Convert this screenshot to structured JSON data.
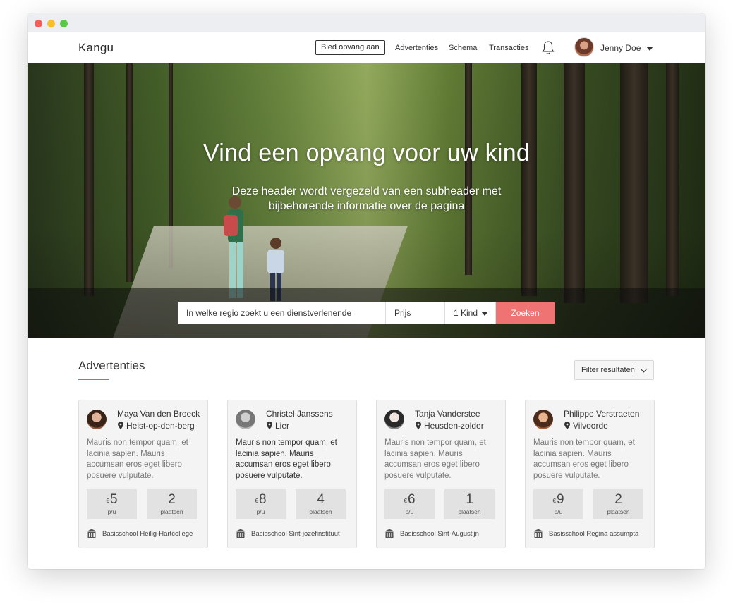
{
  "colors": {
    "accent": "#f07373",
    "underline": "#4a90c6",
    "text": "#333333",
    "muted": "#7a7a7a"
  },
  "brand": {
    "logo": "Kangu"
  },
  "nav": {
    "offer_button": "Bied opvang aan",
    "links": [
      "Advertenties",
      "Schema",
      "Transacties"
    ],
    "bell_icon": "bell-icon",
    "user_name": "Jenny Doe"
  },
  "hero": {
    "title": "Vind een opvang voor uw kind",
    "subtitle": "Deze header wordt vergezeld van een subheader met bijbehorende informatie over de pagina"
  },
  "search": {
    "region_placeholder": "In welke regio zoekt u een dienstverlenende ouder?",
    "price_placeholder": "Prijs (max.)",
    "kids_value": "1 Kind",
    "submit_label": "Zoeken"
  },
  "listings": {
    "title": "Advertenties",
    "filter_label": "Filter resultaten",
    "cards": [
      {
        "name": "Maya Van den Broeck",
        "location": "Heist-op-den-berg",
        "description": "Mauris non tempor quam, et lacinia sapien. Mauris accumsan eros eget libero posuere vulputate.",
        "price_currency": "€",
        "price": "5",
        "price_unit": "p/u",
        "spots": "2",
        "spots_label": "plaatsen",
        "school": "Basisschool Heilig-Hartcollege"
      },
      {
        "name": "Christel Janssens",
        "location": "Lier",
        "description": "Mauris non tempor quam, et lacinia sapien. Mauris accumsan eros eget libero posuere vulputate.",
        "price_currency": "€",
        "price": "8",
        "price_unit": "p/u",
        "spots": "4",
        "spots_label": "plaatsen",
        "school": "Basisschool Sint-jozefinstituut"
      },
      {
        "name": "Tanja Vanderstee",
        "location": "Heusden-zolder",
        "description": "Mauris non tempor quam, et lacinia sapien. Mauris accumsan eros eget libero posuere vulputate.",
        "price_currency": "€",
        "price": "6",
        "price_unit": "p/u",
        "spots": "1",
        "spots_label": "plaatsen",
        "school": "Basisschool Sint-Augustijn"
      },
      {
        "name": "Philippe Verstraeten",
        "location": "Vilvoorde",
        "description": "Mauris non tempor quam, et lacinia sapien. Mauris accumsan eros eget libero posuere vulputate.",
        "price_currency": "€",
        "price": "9",
        "price_unit": "p/u",
        "spots": "2",
        "spots_label": "plaatsen",
        "school": "Basisschool Regina assumpta"
      }
    ]
  }
}
